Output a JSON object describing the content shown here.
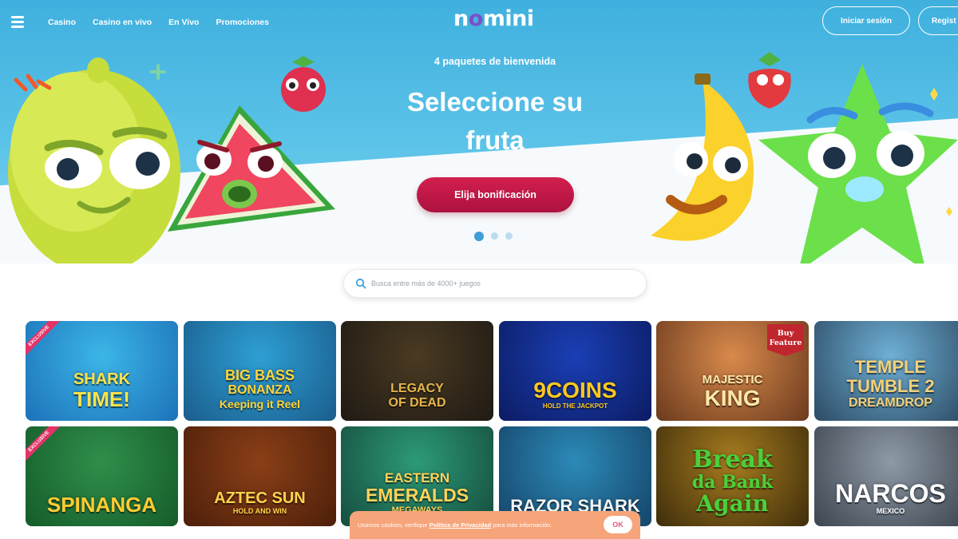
{
  "header": {
    "nav": [
      "Casino",
      "Casino en vivo",
      "En Vivo",
      "Promociones"
    ],
    "logo": {
      "pre": "n",
      "o": "o",
      "post": "mini"
    },
    "login_label": "Iniciar sesión",
    "register_label": "Regist"
  },
  "hero": {
    "kicker": "4 paquetes de bienvenida",
    "title": "Seleccione su fruta",
    "cta_label": "Elija bonificación",
    "slides": 3,
    "active_slide": 1
  },
  "search": {
    "placeholder": "Busca entre más de 4000+ juegos"
  },
  "games": [
    {
      "title_lines": [
        "SHARK",
        "TIME!"
      ],
      "badge": "EXCLUSIVE",
      "colors": [
        "#3bb6e8",
        "#1d72b8"
      ],
      "text_color": "#ffe34a"
    },
    {
      "title_lines": [
        "BIG BASS",
        "BONANZA",
        "Keeping it Reel"
      ],
      "colors": [
        "#2e9fd4",
        "#1a5d8c"
      ],
      "text_color": "#ffd53b"
    },
    {
      "title_lines": [
        "LEGACY",
        "OF DEAD"
      ],
      "colors": [
        "#4a3a22",
        "#1f1a14"
      ],
      "text_color": "#e6b54a"
    },
    {
      "title_lines": [
        "9COINS",
        "HOLD THE JACKPOT"
      ],
      "colors": [
        "#1a3fb5",
        "#0c1c63"
      ],
      "text_color": "#ffc81f"
    },
    {
      "title_lines": [
        "MAJESTIC",
        "KING"
      ],
      "badge_buy": "Buy Feature",
      "colors": [
        "#d98a4c",
        "#6b3a1d"
      ],
      "text_color": "#ffe7a8"
    },
    {
      "title_lines": [
        "TEMPLE",
        "TUMBLE 2",
        "DREAMDROP"
      ],
      "colors": [
        "#6fb0d6",
        "#2c4a63"
      ],
      "text_color": "#f3d079"
    },
    {
      "title_lines": [
        "SPINANGA"
      ],
      "badge": "EXCLUSIVE",
      "colors": [
        "#2f8f4a",
        "#155c2a"
      ],
      "text_color": "#ffcc33"
    },
    {
      "title_lines": [
        "AZTEC SUN",
        "HOLD AND WIN"
      ],
      "colors": [
        "#8a3f17",
        "#4d1f0a"
      ],
      "text_color": "#ffd34d"
    },
    {
      "title_lines": [
        "EASTERN",
        "EMERALDS",
        "MEGAWAYS"
      ],
      "colors": [
        "#2c9a78",
        "#164d3e"
      ],
      "text_color": "#ffd35a"
    },
    {
      "title_lines": [
        "RAZOR SHARK"
      ],
      "colors": [
        "#2c8ab8",
        "#15456a"
      ],
      "text_color": "#f4f4f4"
    },
    {
      "title_lines": [
        "Break",
        "da Bank",
        "Again"
      ],
      "colors": [
        "#a77c1f",
        "#3e2d0b"
      ],
      "text_color": "#49d13a"
    },
    {
      "title_lines": [
        "NARCOS",
        "MEXICO"
      ],
      "colors": [
        "#8e9aa6",
        "#3c4550"
      ],
      "text_color": "#ffffff"
    }
  ],
  "cookie": {
    "text_before": "Usamos cookies, verifique ",
    "link_label": "Política de Privacidad",
    "text_after": " para más información.",
    "ok_label": "OK"
  },
  "colors": {
    "hero_sky": "#4ab6e2",
    "cta": "#c8174a",
    "logo_accent": "#7b4fc9",
    "cookie": "#f6a47a"
  },
  "icons": {
    "menu": "hamburger-icon",
    "search": "search-icon"
  }
}
